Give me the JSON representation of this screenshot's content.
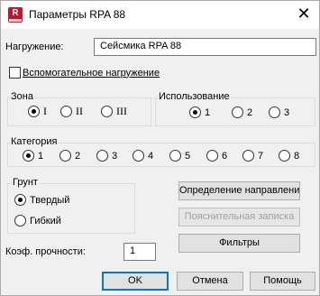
{
  "window": {
    "title": "Параметры RPA 88",
    "icon_letter": "R",
    "close_glyph": "✕"
  },
  "loading": {
    "label": "Нагружение:",
    "value": "Сейсмика RPA 88"
  },
  "auxiliary": {
    "label": "Вспомогательное нагружение",
    "checked": false
  },
  "zone": {
    "title": "Зона",
    "options": [
      "I",
      "II",
      "III"
    ],
    "selected": "I"
  },
  "usage": {
    "title": "Использование",
    "options": [
      "1",
      "2",
      "3"
    ],
    "selected": "1"
  },
  "category": {
    "title": "Категория",
    "options": [
      "1",
      "2",
      "3",
      "4",
      "5",
      "6",
      "7",
      "8"
    ],
    "selected": "1"
  },
  "soil": {
    "title": "Грунт",
    "options": [
      "Твердый",
      "Гибкий"
    ],
    "selected": "Твердый"
  },
  "strength": {
    "label": "Коэф. прочности:",
    "value": "1"
  },
  "buttons": {
    "direction": "Определение направления",
    "note": "Пояснительная записка",
    "filters": "Фильтры",
    "ok": "OK",
    "cancel": "Отмена",
    "help": "Помощь"
  },
  "colors": {
    "accent": "#0078d7",
    "icon": "#c8102e"
  }
}
